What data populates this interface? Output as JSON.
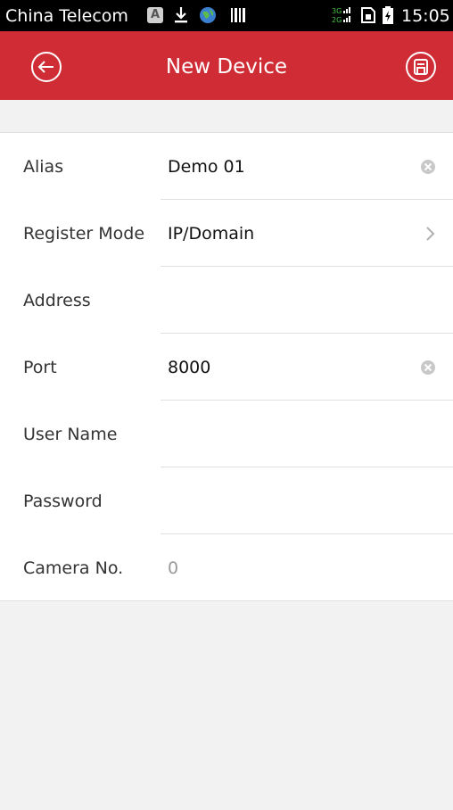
{
  "status_bar": {
    "carrier": "China Telecom",
    "notification_badge": "A",
    "network_label": "3G 2G",
    "time": "15:05"
  },
  "header": {
    "title": "New Device",
    "back_icon": "back-arrow-circle-icon",
    "save_icon": "save-disk-icon",
    "background_color": "#cf2c35"
  },
  "form": {
    "fields": [
      {
        "label": "Alias",
        "value": "Demo 01",
        "placeholder": "",
        "trailing": "clear"
      },
      {
        "label": "Register Mode",
        "value": "IP/Domain",
        "placeholder": "",
        "trailing": "chevron"
      },
      {
        "label": "Address",
        "value": "",
        "placeholder": "",
        "trailing": "none"
      },
      {
        "label": "Port",
        "value": "8000",
        "placeholder": "",
        "trailing": "clear"
      },
      {
        "label": "User Name",
        "value": "",
        "placeholder": "",
        "trailing": "none"
      },
      {
        "label": "Password",
        "value": "",
        "placeholder": "",
        "trailing": "none"
      },
      {
        "label": "Camera No.",
        "value": "",
        "placeholder": "0",
        "trailing": "none"
      }
    ]
  }
}
